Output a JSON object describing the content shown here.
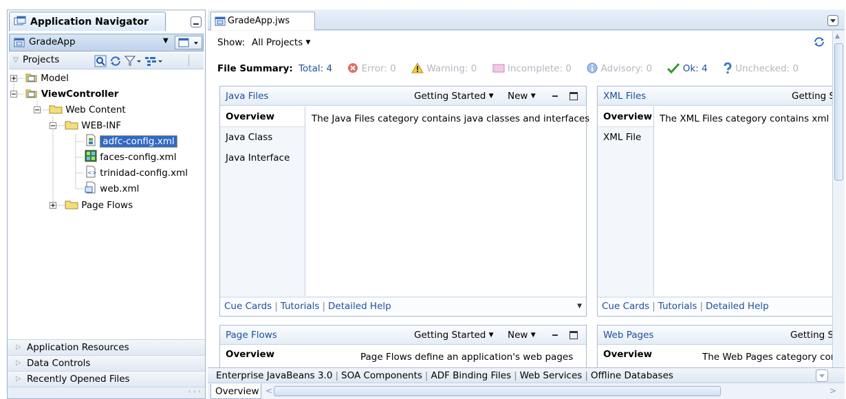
{
  "navigator": {
    "title": "Application Navigator",
    "application": "GradeApp",
    "projects_label": "Projects",
    "tree": [
      {
        "label": "Model"
      },
      {
        "label": "ViewController"
      },
      {
        "label": "Web Content"
      },
      {
        "label": "WEB-INF"
      },
      {
        "label": "adfc-config.xml"
      },
      {
        "label": "faces-config.xml"
      },
      {
        "label": "trinidad-config.xml"
      },
      {
        "label": "web.xml"
      },
      {
        "label": "Page Flows"
      }
    ],
    "accordion": [
      "Application Resources",
      "Data Controls",
      "Recently Opened Files"
    ],
    "scroll_arrows": "‹ ‹ ‹"
  },
  "editor": {
    "tab_label": "GradeApp.jws",
    "show_label": "Show:",
    "show_value": "All Projects",
    "summary": {
      "label": "File Summary:",
      "total": "Total: 4",
      "error": "Error: 0",
      "warning": "Warning: 0",
      "incomplete": "Incomplete: 0",
      "advisory": "Advisory: 0",
      "ok": "Ok: 4",
      "unchecked": "Unchecked: 0"
    },
    "panels": {
      "java": {
        "title": "Java Files",
        "getting_started": "Getting Started",
        "new": "New",
        "items": [
          "Overview",
          "Java Class",
          "Java Interface"
        ],
        "description": "The Java Files category contains java classes and interfaces"
      },
      "xml": {
        "title": "XML Files",
        "getting_started": "Getting S",
        "items": [
          "Overview",
          "XML File"
        ],
        "description": "The XML Files category contains xml file"
      },
      "pageflows": {
        "title": "Page Flows",
        "getting_started": "Getting Started",
        "new": "New",
        "overview": "Overview",
        "description": "Page Flows define an application's web pages"
      },
      "webpages": {
        "title": "Web Pages",
        "getting_started": "Getting St",
        "overview": "Overview",
        "description": "The Web Pages category con"
      }
    },
    "footer_links": {
      "cue_cards": "Cue Cards",
      "tutorials": "Tutorials",
      "detailed_help": "Detailed Help"
    },
    "bottom_tabs": [
      "Enterprise JavaBeans 3.0",
      "SOA Components",
      "ADF Binding Files",
      "Web Services",
      "Offline Databases"
    ],
    "overview_tab": "Overview"
  }
}
